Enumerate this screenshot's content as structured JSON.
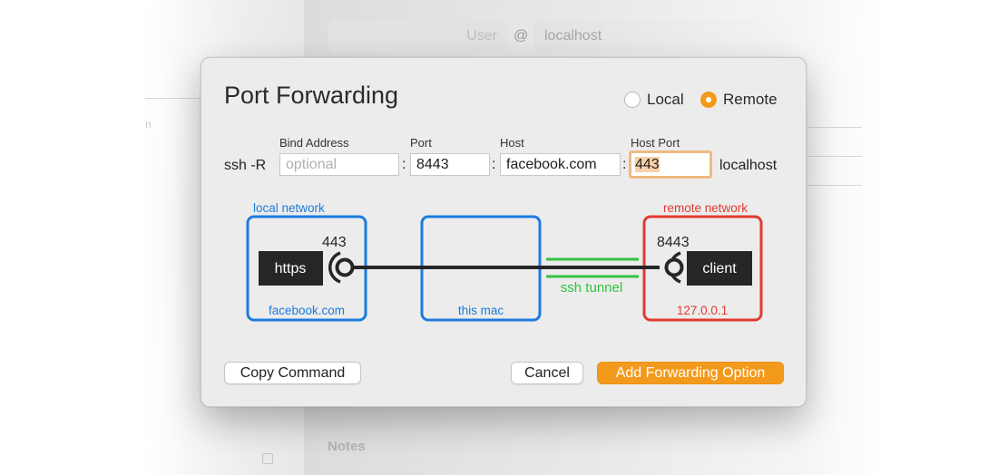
{
  "background": {
    "user_placeholder": "User",
    "at_sign": "@",
    "host_value": "localhost",
    "notes_heading": "Notes",
    "sidebar_hint": "n"
  },
  "dialog": {
    "title": "Port Forwarding",
    "mode_options": [
      {
        "label": "Local",
        "selected": false
      },
      {
        "label": "Remote",
        "selected": true
      }
    ],
    "columns": {
      "bind_address": "Bind Address",
      "port": "Port",
      "host": "Host",
      "host_port": "Host Port"
    },
    "command_prefix": "ssh -R",
    "fields": {
      "bind_address_placeholder": "optional",
      "bind_address_value": "",
      "port_value": "8443",
      "host_value": "facebook.com",
      "host_port_value": "443"
    },
    "colon": ":",
    "suffix": "localhost",
    "diagram": {
      "local_network_label": "local network",
      "remote_network_label": "remote network",
      "local_service": "https",
      "local_port": "443",
      "local_host": "facebook.com",
      "this_mac_label": "this mac",
      "tunnel_label": "ssh tunnel",
      "remote_service": "client",
      "remote_port": "8443",
      "remote_host": "127.0.0.1",
      "colors": {
        "local": "#1c7be0",
        "remote": "#e23a2f",
        "tunnel": "#33c23e",
        "node": "#262626"
      }
    },
    "buttons": {
      "copy": "Copy Command",
      "cancel": "Cancel",
      "add": "Add Forwarding Option"
    },
    "accent_color": "#f39a1d"
  }
}
